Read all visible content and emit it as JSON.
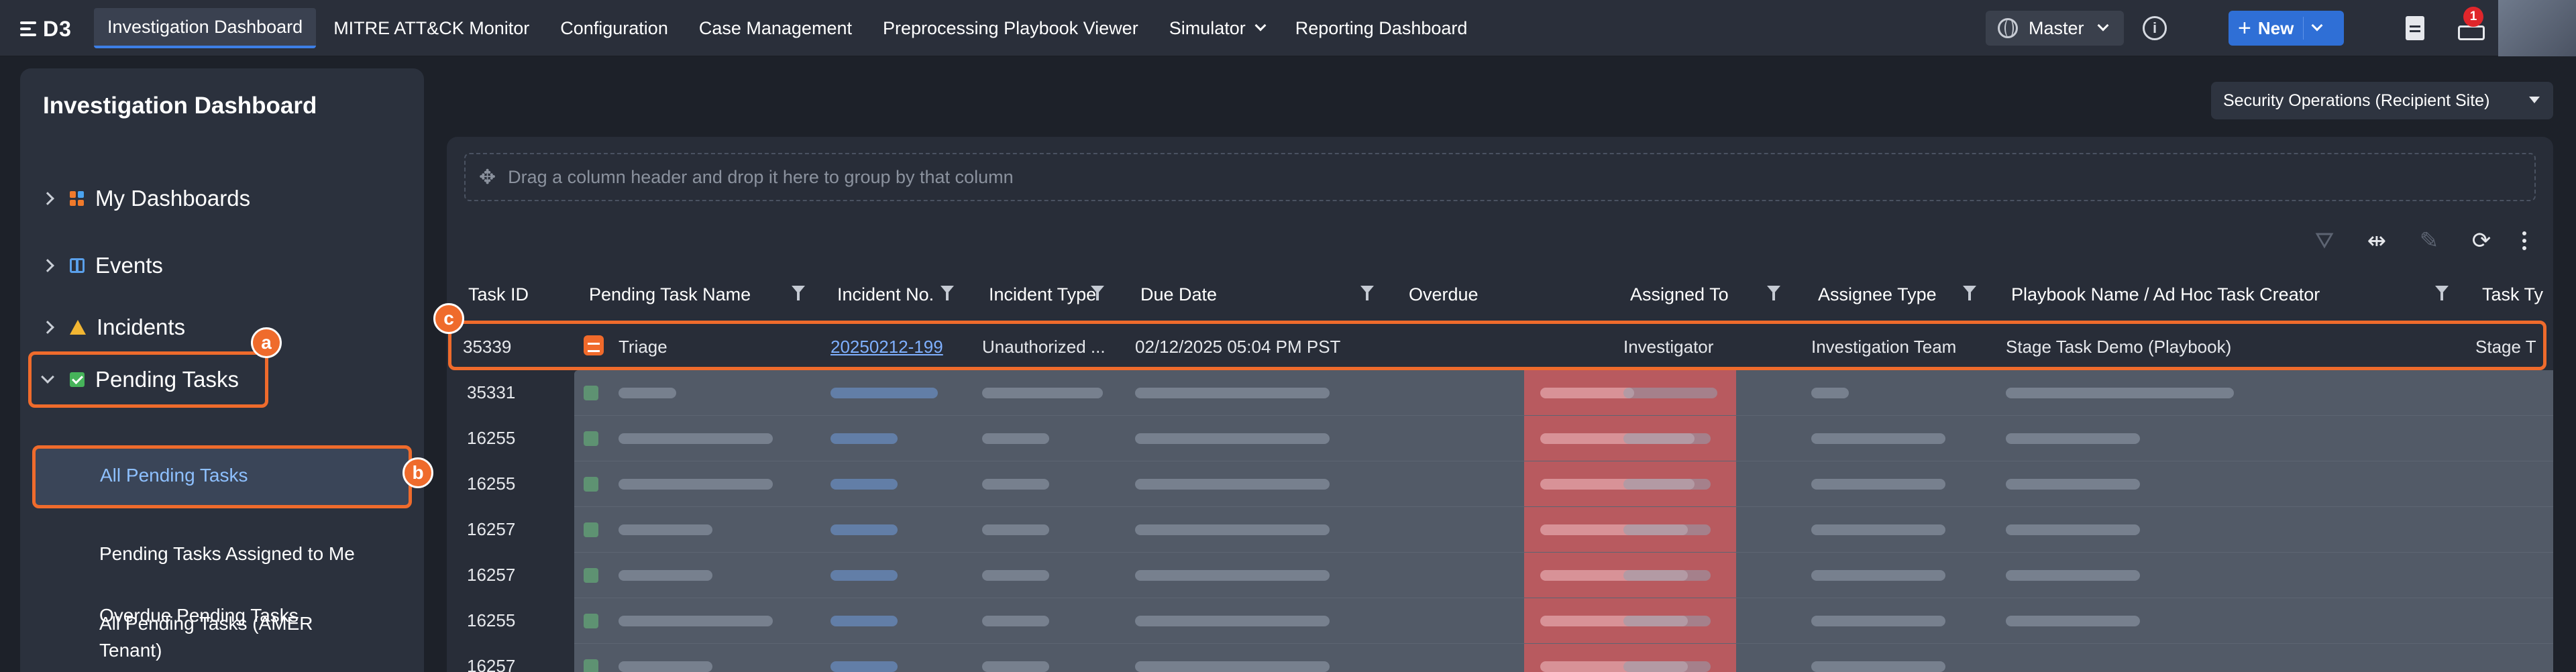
{
  "topbar": {
    "logo": "D3",
    "nav": [
      {
        "label": "Investigation Dashboard",
        "active": true
      },
      {
        "label": "MITRE ATT&CK Monitor"
      },
      {
        "label": "Configuration"
      },
      {
        "label": "Case Management"
      },
      {
        "label": "Preprocessing Playbook Viewer"
      },
      {
        "label": "Simulator",
        "dropdown": true
      },
      {
        "label": "Reporting Dashboard"
      }
    ],
    "site": "Master",
    "new_label": "New",
    "notification_count": "1",
    "accent_color": "#2f6fd6"
  },
  "sidebar": {
    "title": "Investigation Dashboard",
    "items": [
      {
        "label": "My Dashboards",
        "icon": "dashboard-icon"
      },
      {
        "label": "Events",
        "icon": "calendar-icon"
      },
      {
        "label": "Incidents",
        "icon": "warning-icon"
      },
      {
        "label": "Pending Tasks",
        "icon": "checkbox-icon",
        "expanded": true
      }
    ],
    "sub_items": [
      {
        "label": "All Pending Tasks",
        "active": true
      },
      {
        "label": "Pending Tasks Assigned to Me"
      },
      {
        "label": "Overdue Pending Tasks"
      },
      {
        "label": "All Pending Tasks (AMER Tenant)"
      }
    ],
    "markers": [
      "a",
      "b"
    ]
  },
  "main": {
    "site_dropdown": "Security Operations (Recipient Site)",
    "group_hint": "Drag a column header and drop it here to group by that column",
    "marker": "c",
    "columns": [
      "Task ID",
      "Pending Task Name",
      "Incident No.",
      "Incident Type",
      "Due Date",
      "Overdue",
      "Assigned To",
      "Assignee Type",
      "Playbook Name / Ad Hoc Task Creator",
      "Task Ty"
    ],
    "highlighted_row": {
      "task_id": "35339",
      "task_name": "Triage",
      "incident_no": "20250212-199",
      "incident_type": "Unauthorized ...",
      "due_date": "02/12/2025 05:04 PM PST",
      "overdue": "",
      "assigned_to": "Investigator",
      "assignee_type": "Investigation Team",
      "playbook": "Stage Task Demo (Playbook)",
      "task_type": "Stage T"
    },
    "other_task_ids": [
      "35331",
      "16255",
      "16255",
      "16257",
      "16257",
      "16255",
      "16257"
    ],
    "highlight_color": "#ef6b2c"
  }
}
